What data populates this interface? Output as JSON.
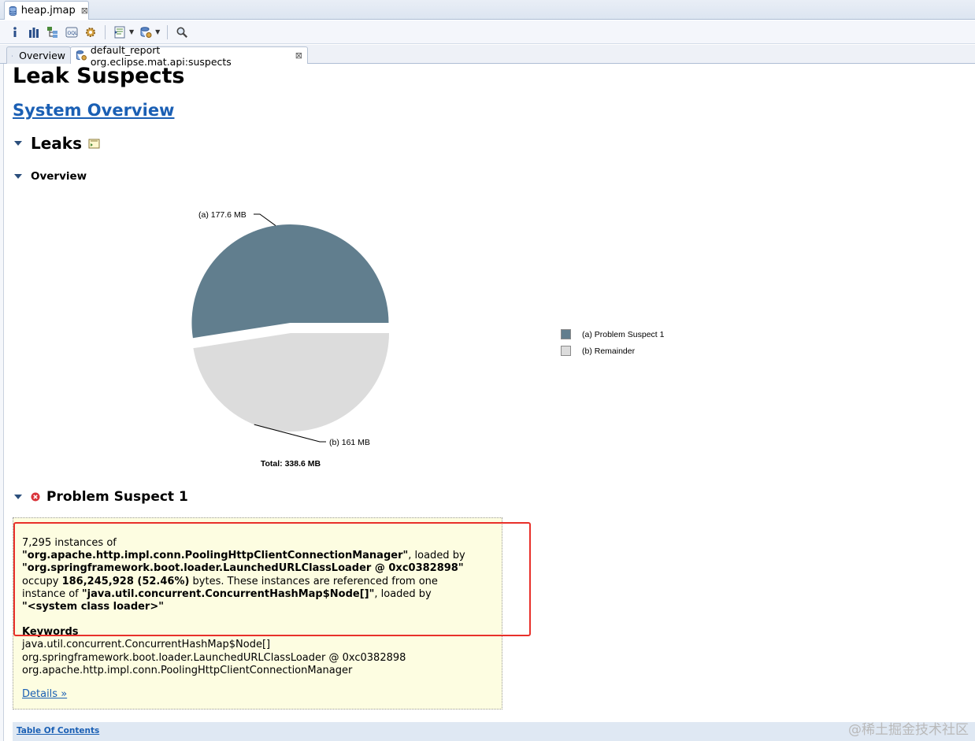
{
  "editor_tab": {
    "label": "heap.jmap",
    "close": "⊠"
  },
  "inner_tabs": [
    {
      "label": "Overview"
    },
    {
      "label": "default_report  org.eclipse.mat.api:suspects",
      "close": "⊠"
    }
  ],
  "report": {
    "title": "Leak Suspects",
    "system_overview_link": "System Overview",
    "leaks_heading": "Leaks",
    "overview_heading": "Overview",
    "suspect_heading": "Problem Suspect 1",
    "suspect": {
      "line1": "7,295 instances of",
      "class_name": "\"org.apache.http.impl.conn.PoolingHttpClientConnectionManager\"",
      "loaded_by_1": ", loaded by",
      "loader": "\"org.springframework.boot.loader.LaunchedURLClassLoader @ 0xc0382898\"",
      "occupy": "occupy ",
      "bytes_value": "186,245,928 (52.46%)",
      "bytes_suffix": " bytes. These instances are referenced from one",
      "instance_of": "instance of ",
      "ref_class": "\"java.util.concurrent.ConcurrentHashMap$Node[]\"",
      "loaded_by_2": ", loaded by",
      "sys_loader": "\"<system class loader>\"",
      "keywords_title": "Keywords",
      "keywords": [
        "java.util.concurrent.ConcurrentHashMap$Node[]",
        "org.springframework.boot.loader.LaunchedURLClassLoader @ 0xc0382898",
        "org.apache.http.impl.conn.PoolingHttpClientConnectionManager"
      ],
      "details_link": "Details »"
    },
    "toc_link": "Table Of Contents"
  },
  "chart_data": {
    "type": "pie",
    "slices": [
      {
        "label": "(a)  177.6 MB",
        "legend": "(a)  Problem Suspect 1",
        "value": 177.6,
        "color": "#617e8e"
      },
      {
        "label": "(b)  161 MB",
        "legend": "(b)  Remainder",
        "value": 161,
        "color": "#dcdcdc"
      }
    ],
    "total_label": "Total: 338.6 MB"
  },
  "watermark": "@稀土掘金技术社区"
}
